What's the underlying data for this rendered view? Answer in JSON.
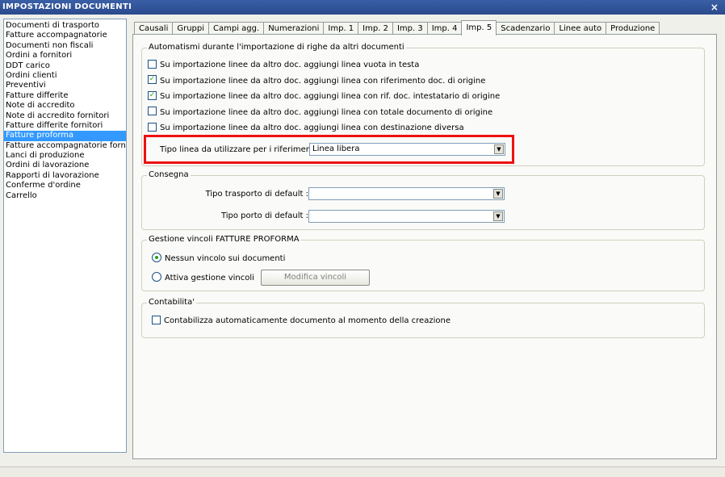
{
  "window": {
    "title": "IMPOSTAZIONI DOCUMENTI",
    "close_label": "×"
  },
  "document_list": [
    "Documenti di trasporto",
    "Fatture accompagnatorie",
    "Documenti non fiscali",
    "Ordini a fornitori",
    "DDT carico",
    "Ordini clienti",
    "Preventivi",
    "Fatture differite",
    "Note di accredito",
    "Note di accredito fornitori",
    "Fatture differite fornitori",
    "Fatture proforma",
    "Fatture accompagnatorie fornito",
    "Lanci di produzione",
    "Ordini di lavorazione",
    "Rapporti di lavorazione",
    "Conferme d'ordine",
    "Carrello"
  ],
  "selected_document": "Fatture proforma",
  "tabs": [
    "Causali",
    "Gruppi",
    "Campi agg.",
    "Numerazioni",
    "Imp. 1",
    "Imp. 2",
    "Imp. 3",
    "Imp. 4",
    "Imp. 5",
    "Scadenzario",
    "Linee auto",
    "Produzione"
  ],
  "active_tab": "Imp. 5",
  "import_group": {
    "title": "Automatismi durante l'importazione di righe da altri documenti",
    "options": [
      {
        "label": "Su importazione linee da altro doc. aggiungi linea vuota in testa",
        "checked": false
      },
      {
        "label": "Su importazione linee da altro doc. aggiungi linea con riferimento doc. di origine",
        "checked": true
      },
      {
        "label": "Su importazione linee da altro doc. aggiungi linea con rif. doc. intestatario di origine",
        "checked": true
      },
      {
        "label": "Su importazione linee da altro doc. aggiungi linea con totale documento di origine",
        "checked": false
      },
      {
        "label": "Su importazione linee da altro doc. aggiungi linea con destinazione diversa",
        "checked": false
      }
    ],
    "line_type_label": "Tipo linea da utilizzare per i riferimenti :",
    "line_type_value": "Linea libera"
  },
  "delivery_group": {
    "title": "Consegna",
    "transport_label": "Tipo trasporto di default :",
    "transport_value": "",
    "port_label": "Tipo porto di default :",
    "port_value": ""
  },
  "constraints_group": {
    "title": "Gestione vincoli FATTURE PROFORMA",
    "option_none": "Nessun vincolo sui documenti",
    "option_active": "Attiva gestione vincoli",
    "selected": "none",
    "modify_button": "Modifica vincoli"
  },
  "accounting_group": {
    "title": "Contabilita'",
    "auto_label": "Contabilizza automaticamente documento al momento della creazione",
    "auto_checked": false
  },
  "colors": {
    "title_bar": "#2f54a0",
    "selection": "#3399ff",
    "highlight": "#ee1111",
    "check": "#21a121"
  }
}
